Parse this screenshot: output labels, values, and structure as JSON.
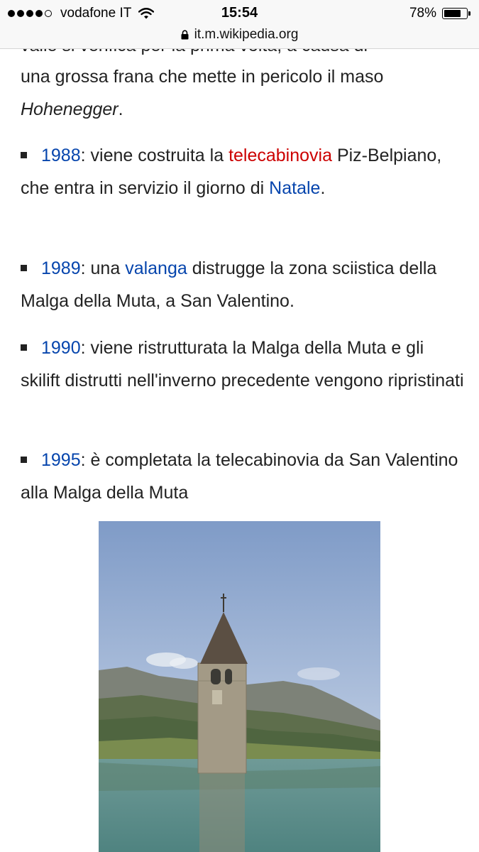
{
  "status_bar": {
    "carrier": "vodafone IT",
    "time": "15:54",
    "battery_percent": "78%",
    "battery_level": 0.78,
    "signal_bars_filled": 4,
    "signal_bars_total": 5
  },
  "url_bar": {
    "url": "it.m.wikipedia.org"
  },
  "article": {
    "intro": {
      "partial_text": "valle si verifica per la prima volta, a causa di",
      "line1": "una grossa frana che mette in pericolo il maso",
      "italic": "Hohenegger",
      "end": "."
    },
    "items": [
      {
        "year": "1988",
        "t1": ": viene costruita la ",
        "redlink": "telecabinovia",
        "t2": " Piz-Belpiano, che entra in servizio il giorno di ",
        "link2": "Natale",
        "t3": "."
      },
      {
        "year": "1989",
        "t1": ": una ",
        "link2": "valanga",
        "t2": " distrugge la zona sciistica della Malga della Muta, a San Valentino."
      },
      {
        "year": "1990",
        "t1": ": viene ristrutturata la Malga della Muta e gli skilift distrutti nell'inverno precedente vengono ripristinati"
      },
      {
        "year": "1995",
        "t1": ": è completata la telecabinovia da San Valentino alla Malga della Muta"
      }
    ]
  },
  "colors": {
    "link": "#0645ad",
    "redlink": "#cc0000",
    "text": "#222222",
    "chrome": "#f8f8f8"
  },
  "icons": {
    "wifi": "wifi-icon",
    "lock": "lock-icon",
    "battery": "battery-icon"
  }
}
